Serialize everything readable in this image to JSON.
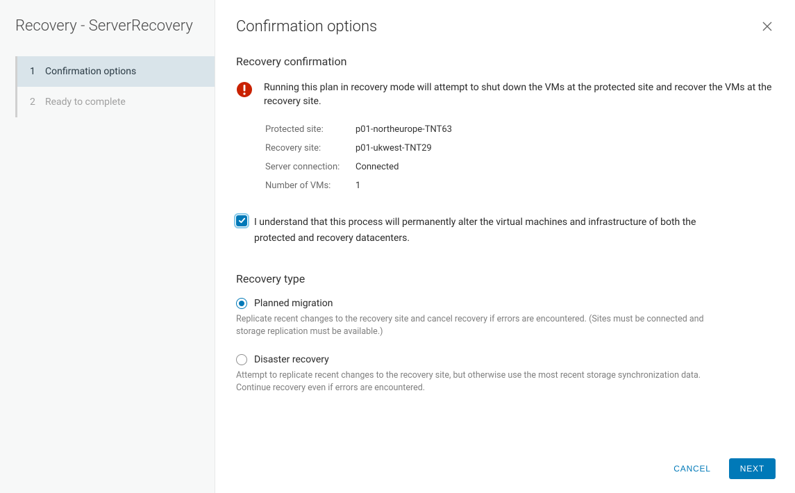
{
  "sidebar": {
    "title": "Recovery - ServerRecovery",
    "steps": [
      {
        "num": "1",
        "label": "Confirmation options",
        "active": true
      },
      {
        "num": "2",
        "label": "Ready to complete",
        "active": false
      }
    ]
  },
  "main": {
    "title": "Confirmation options",
    "recovery_confirmation": {
      "heading": "Recovery confirmation",
      "warning": "Running this plan in recovery mode will attempt to shut down the VMs at the protected site and recover the VMs at the recovery site.",
      "fields": {
        "protected_site_label": "Protected site:",
        "protected_site_value": "p01-northeurope-TNT63",
        "recovery_site_label": "Recovery site:",
        "recovery_site_value": "p01-ukwest-TNT29",
        "server_connection_label": "Server connection:",
        "server_connection_value": "Connected",
        "num_vms_label": "Number of VMs:",
        "num_vms_value": "1"
      },
      "consent": {
        "checked": true,
        "text": "I understand that this process will permanently alter the virtual machines and infrastructure of both the protected and recovery datacenters."
      }
    },
    "recovery_type": {
      "heading": "Recovery type",
      "options": [
        {
          "id": "planned",
          "label": "Planned migration",
          "description": "Replicate recent changes to the recovery site and cancel recovery if errors are encountered. (Sites must be connected and storage replication must be available.)",
          "selected": true
        },
        {
          "id": "disaster",
          "label": "Disaster recovery",
          "description": "Attempt to replicate recent changes to the recovery site, but otherwise use the most recent storage synchronization data. Continue recovery even if errors are encountered.",
          "selected": false
        }
      ]
    }
  },
  "footer": {
    "cancel": "CANCEL",
    "next": "NEXT"
  }
}
